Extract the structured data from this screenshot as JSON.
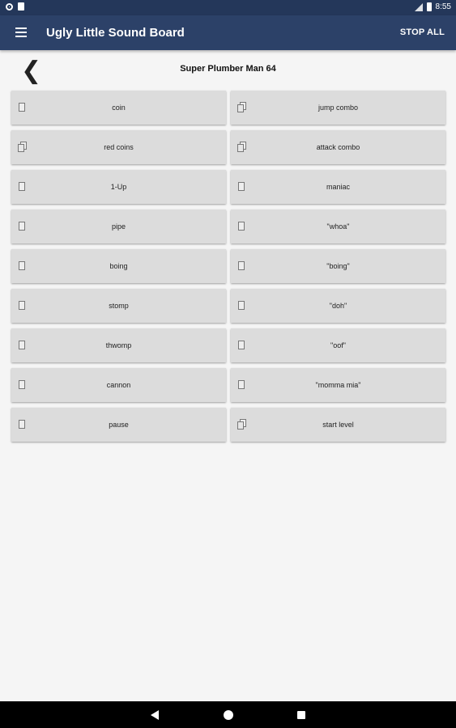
{
  "status_bar": {
    "time": "8:55"
  },
  "app_bar": {
    "title": "Ugly Little Sound Board",
    "stop_all": "STOP ALL"
  },
  "page": {
    "title": "Super Plumber Man 64",
    "back_icon": "back-chevron-icon"
  },
  "sounds": [
    {
      "label": "coin",
      "icon": "single"
    },
    {
      "label": "jump combo",
      "icon": "multi"
    },
    {
      "label": "red coins",
      "icon": "multi"
    },
    {
      "label": "attack combo",
      "icon": "multi"
    },
    {
      "label": "1-Up",
      "icon": "single"
    },
    {
      "label": "maniac",
      "icon": "single"
    },
    {
      "label": "pipe",
      "icon": "single"
    },
    {
      "label": "\"whoa\"",
      "icon": "single"
    },
    {
      "label": "boing",
      "icon": "single"
    },
    {
      "label": "\"boing\"",
      "icon": "single"
    },
    {
      "label": "stomp",
      "icon": "single"
    },
    {
      "label": "\"doh\"",
      "icon": "single"
    },
    {
      "label": "thwomp",
      "icon": "single"
    },
    {
      "label": "\"oof\"",
      "icon": "single"
    },
    {
      "label": "cannon",
      "icon": "single"
    },
    {
      "label": "\"momma mia\"",
      "icon": "single"
    },
    {
      "label": "pause",
      "icon": "single"
    },
    {
      "label": "start level",
      "icon": "multi"
    }
  ]
}
